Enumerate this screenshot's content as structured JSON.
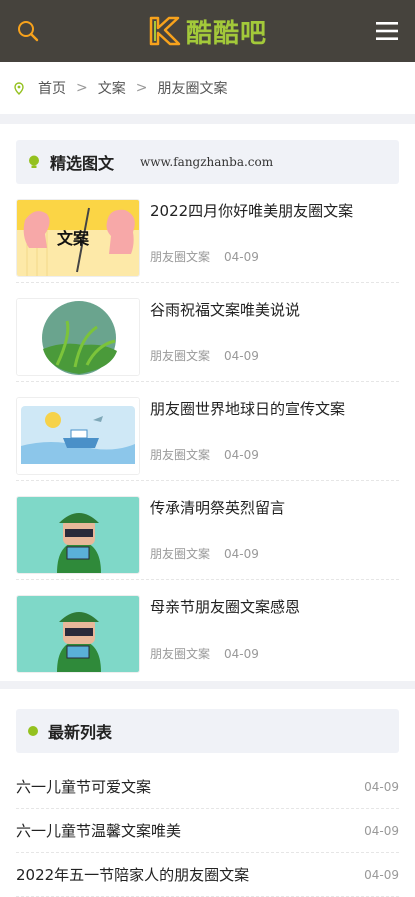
{
  "header": {
    "logo_text": "酷酷吧",
    "logo_letter": "K",
    "search_icon": "search-icon",
    "menu_icon": "menu-icon"
  },
  "breadcrumb": [
    "首页",
    "文案",
    "朋友圈文案"
  ],
  "featured": {
    "title": "精选图文",
    "url": "www.fangzhanba.com",
    "articles": [
      {
        "title": "2022四月你好唯美朋友圈文案",
        "category": "朋友圈文案",
        "date": "04-09",
        "thumb_text": "文案"
      },
      {
        "title": "谷雨祝福文案唯美说说",
        "category": "朋友圈文案",
        "date": "04-09"
      },
      {
        "title": "朋友圈世界地球日的宣传文案",
        "category": "朋友圈文案",
        "date": "04-09"
      },
      {
        "title": "传承清明祭英烈留言",
        "category": "朋友圈文案",
        "date": "04-09"
      },
      {
        "title": "母亲节朋友圈文案感恩",
        "category": "朋友圈文案",
        "date": "04-09"
      }
    ]
  },
  "latest": {
    "title": "最新列表",
    "items": [
      {
        "title": "六一儿童节可爱文案",
        "date": "04-09"
      },
      {
        "title": "六一儿童节温馨文案唯美",
        "date": "04-09"
      },
      {
        "title": "2022年五一节陪家人的朋友圈文案",
        "date": "04-09"
      }
    ]
  },
  "colors": {
    "header_bg": "#46433d",
    "accent": "#94c11f",
    "logo_orange": "#f7a21c"
  }
}
